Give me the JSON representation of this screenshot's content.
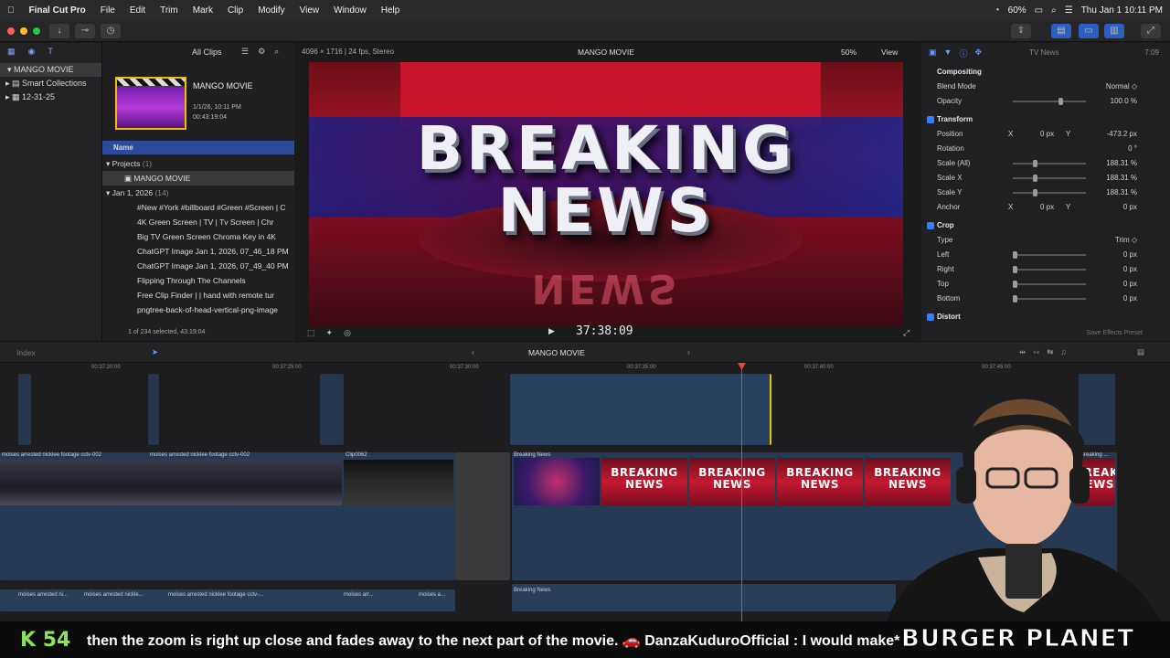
{
  "menubar": {
    "app": "Final Cut Pro",
    "items": [
      "File",
      "Edit",
      "Trim",
      "Mark",
      "Clip",
      "Modify",
      "View",
      "Window",
      "Help"
    ],
    "battery": "60%",
    "clock": "Thu Jan 1  10:11 PM"
  },
  "library": {
    "name": "MANGO MOVIE",
    "smart": "Smart Collections",
    "event": "12-31-25"
  },
  "browser": {
    "filter": "All Clips",
    "project_title": "MANGO MOVIE",
    "project_date": "1/1/26, 10:11 PM",
    "project_duration": "00:43:19:04",
    "col_name": "Name",
    "projects_label": "Projects",
    "projects_count": "(1)",
    "project_row": "MANGO MOVIE",
    "date_group": "Jan 1, 2026",
    "date_count": "(14)",
    "rows": [
      "#New #York #billboard #Green #Screen | C",
      "4K Green Screen  |  TV  |  Tv Screen  |  Chr",
      "Big TV Green Screen Chroma Key in 4K",
      "ChatGPT Image Jan 1, 2026, 07_46_18 PM",
      "ChatGPT Image Jan 1, 2026, 07_49_40 PM",
      "Flipping Through The Channels",
      "Free Clip Finder  |  |  hand with remote tur",
      "pngtree-back-of-head-vertical-png-image"
    ],
    "status": "1 of 234 selected, 43:19:04"
  },
  "viewer": {
    "format": "4096 × 1716 | 24 fps, Stereo",
    "title": "MANGO MOVIE",
    "zoom": "50%",
    "view": "View",
    "timecode": "37:38:09",
    "frame_line1": "BREAKING",
    "frame_line2": "NEWS"
  },
  "inspector": {
    "header": "TV News",
    "duration": "7:09",
    "compositing": "Compositing",
    "blend_mode_label": "Blend Mode",
    "blend_mode": "Normal ◇",
    "opacity_label": "Opacity",
    "opacity": "100.0 %",
    "transform": "Transform",
    "position_label": "Position",
    "pos_x_label": "X",
    "pos_x": "0 px",
    "pos_y_label": "Y",
    "pos_y": "-473.2 px",
    "rotation_label": "Rotation",
    "rotation": "0 °",
    "scale_all_label": "Scale (All)",
    "scale_all": "188.31 %",
    "scale_x_label": "Scale X",
    "scale_x": "188.31 %",
    "scale_y_label": "Scale Y",
    "scale_y": "188.31 %",
    "anchor_label": "Anchor",
    "anchor_x_label": "X",
    "anchor_x": "0 px",
    "anchor_y_label": "Y",
    "anchor_y": "0 px",
    "crop": "Crop",
    "type_label": "Type",
    "type": "Trim ◇",
    "left_label": "Left",
    "left": "0 px",
    "right_label": "Right",
    "right": "0 px",
    "top_label": "Top",
    "top": "0 px",
    "bottom_label": "Bottom",
    "bottom": "0 px",
    "distort": "Distort",
    "save_preset": "Save Effects Preset"
  },
  "timeline": {
    "index": "Index",
    "project": "MANGO MOVIE",
    "ruler": [
      "00:37:20:00",
      "00:37:25:00",
      "00:37:30:00",
      "00:37:35:00",
      "00:37:40:00",
      "00:37:45:00"
    ],
    "clip_cctv1": "moises arrested nicklee footage cctv-002",
    "clip_cctv2": "moises arrested nicklee footage cctv-002",
    "clip_0062": "Clip0062",
    "clip_bn": "Breaking News",
    "clip_bn2": "Breaking ...",
    "clip_bn_lower": "Breaking News",
    "thumb_text": "BREAKING NEWS",
    "lower_clips": [
      "moises arrested ni...",
      "moises arrested nickle...",
      "moises arrested nicklee footage cctv-...",
      "moises arr...",
      "moises a..."
    ]
  },
  "stream": {
    "badge": "K 54",
    "caption": "then the zoom is right up close and fades away to the next part of the movie.  🚗  DanzaKuduroOfficial : I would make*",
    "brand": "BURGER PLANET"
  }
}
